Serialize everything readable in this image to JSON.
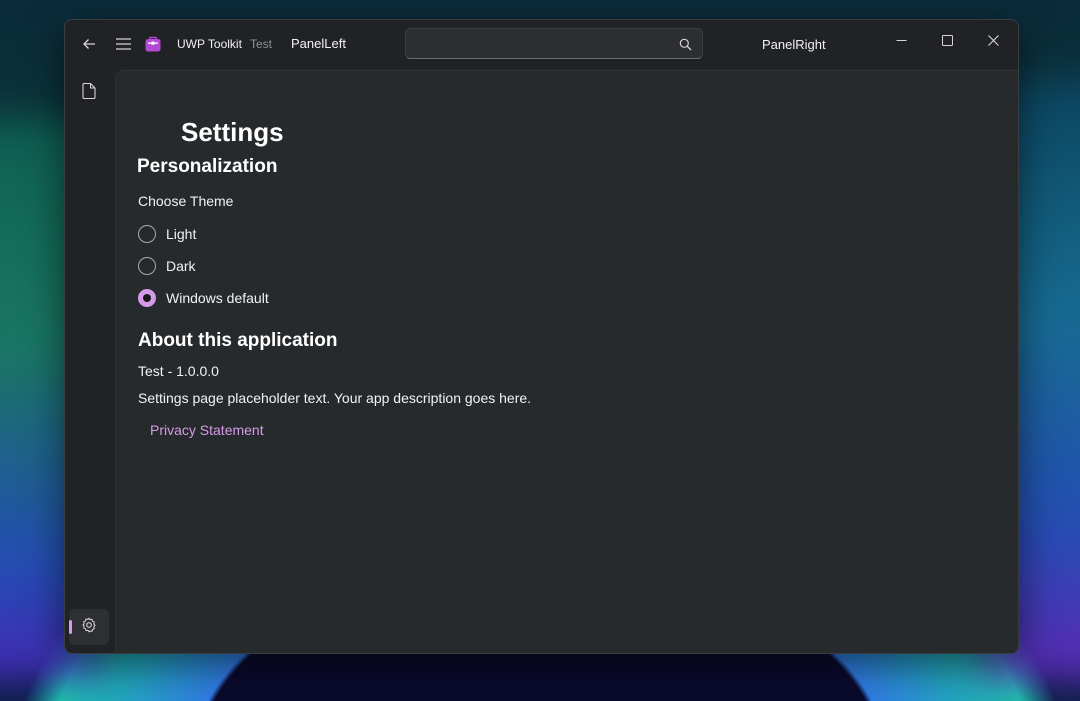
{
  "colors": {
    "accent": "#d69be8",
    "window_bg": "#202225",
    "content_bg": "#272a2c",
    "text": "#f2f2f2",
    "muted_text": "#8f9295"
  },
  "titlebar": {
    "back_icon": "back-arrow-icon",
    "menu_icon": "hamburger-menu-icon",
    "app_icon": "toolbox-icon",
    "app_title": "UWP Toolkit",
    "app_subtitle": "Test",
    "panel_left": "PanelLeft",
    "search": {
      "value": "",
      "placeholder": "",
      "icon": "search-icon"
    },
    "panel_right": "PanelRight",
    "window_controls": [
      "minimize-icon",
      "maximize-icon",
      "close-icon"
    ]
  },
  "navigation": {
    "items": [
      {
        "icon": "document-icon",
        "selected": false
      }
    ],
    "footer": {
      "icon": "gear-icon",
      "selected": true
    }
  },
  "settings": {
    "title": "Settings",
    "personalization": {
      "heading": "Personalization",
      "theme_label": "Choose Theme",
      "options": [
        {
          "label": "Light",
          "checked": false
        },
        {
          "label": "Dark",
          "checked": false
        },
        {
          "label": "Windows default",
          "checked": true
        }
      ]
    },
    "about": {
      "heading": "About this application",
      "version": "Test - 1.0.0.0",
      "description": "Settings page placeholder text.  Your app description goes here.",
      "privacy_link": "Privacy Statement"
    }
  }
}
